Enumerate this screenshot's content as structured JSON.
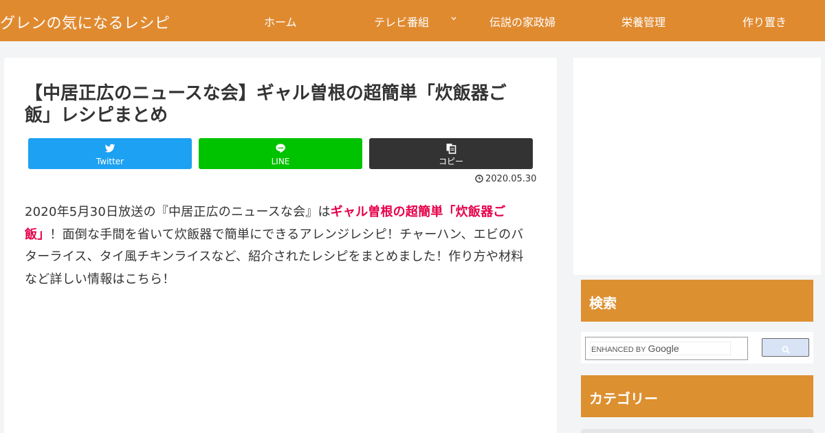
{
  "header": {
    "site_title": "グレンの気になるレシピ",
    "nav": [
      {
        "label": "ホーム"
      },
      {
        "label": "テレビ番組"
      },
      {
        "label": "伝説の家政婦"
      },
      {
        "label": "栄養管理"
      },
      {
        "label": "作り置き"
      }
    ]
  },
  "article": {
    "title": "【中居正広のニュースな会】ギャル曽根の超簡単「炊飯器ご飯」レシピまとめ",
    "date": "2020.05.30",
    "body_before": "2020年5月30日放送の『中居正広のニュースな会』は",
    "body_highlight": "ギャル曽根の超簡単「炊飯器ご飯」",
    "body_after": "！面倒な手間を省いて炊飯器で簡単にできるアレンジレシピ！チャーハン、エビのバターライス、タイ風チキンライスなど、紹介されたレシピをまとめました！作り方や材料など詳しい情報はこちら！"
  },
  "share": {
    "twitter": "Twitter",
    "line": "LINE",
    "copy": "コピー"
  },
  "sidebar": {
    "search_title": "検索",
    "search_placeholder_prefix": "ENHANCED BY",
    "search_placeholder_brand": "Google",
    "category_title": "カテゴリー"
  },
  "colors": {
    "header_bg": "#e08a30",
    "widget_head_bg": "#dd9030",
    "twitter": "#1da1f2",
    "line": "#00c300",
    "copy": "#333333",
    "highlight": "#e6004a"
  }
}
